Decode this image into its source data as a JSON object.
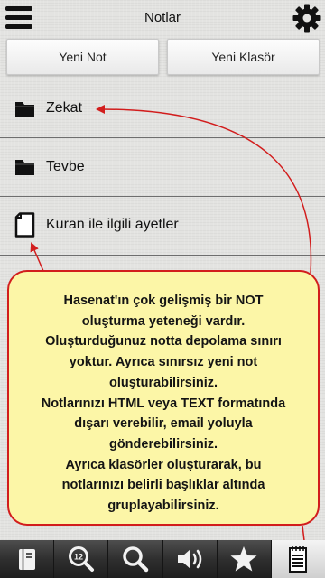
{
  "header": {
    "title": "Notlar"
  },
  "toolbar": {
    "new_note_label": "Yeni Not",
    "new_folder_label": "Yeni Klasör"
  },
  "list": {
    "items": [
      {
        "label": "Zekat",
        "icon": "folder-icon"
      },
      {
        "label": "Tevbe",
        "icon": "folder-icon"
      },
      {
        "label": "Kuran ile ilgili ayetler",
        "icon": "note-file-icon"
      }
    ]
  },
  "tooltip": {
    "text": "Hasenat'ın çok gelişmiş bir NOT\noluşturma yeteneği vardır.\nOluşturduğunuz notta depolama sınırı\nyoktur. Ayrıca sınırsız yeni not\noluşturabilirsiniz.\nNotlarınızı HTML veya TEXT formatında\ndışarı verebilir, email yoluyla\ngönderebilirsiniz.\nAyrıca klasörler oluşturarak, bu\nnotlarınızı belirli başlıklar altında\ngruplayabilirsiniz.",
    "badge_number": "12"
  },
  "tabbar": {
    "tabs": [
      {
        "name": "book",
        "icon": "book-icon"
      },
      {
        "name": "verse-search",
        "icon": "numbered-search-icon"
      },
      {
        "name": "search",
        "icon": "search-icon"
      },
      {
        "name": "audio",
        "icon": "speaker-icon"
      },
      {
        "name": "favorites",
        "icon": "star-icon"
      },
      {
        "name": "notes",
        "icon": "notepad-icon",
        "active": true
      }
    ]
  },
  "colors": {
    "tooltip_bg": "#fcf6a7",
    "tooltip_border": "#d21d1d",
    "arrow": "#d21d1d",
    "tabbar_bg": "#2f2f2f"
  }
}
